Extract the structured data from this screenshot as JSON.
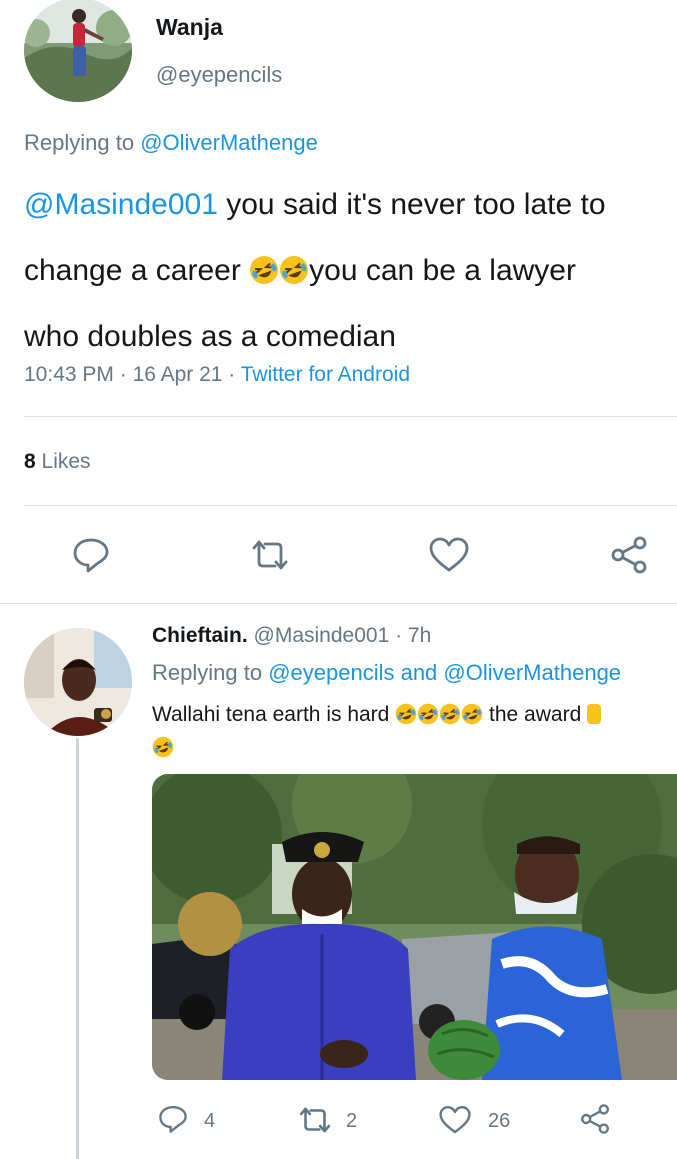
{
  "tweet": {
    "author_name": "Wanja",
    "author_handle": "@eyepencils",
    "replying_prefix": "Replying to ",
    "replying_to": "@OliverMathenge",
    "mention": "@Masinde001",
    "text_1": " you said it's never too late to",
    "text_2a": "change a career ",
    "text_2b": "you can be a lawyer",
    "text_3": "who doubles as a comedian",
    "time": "10:43 PM",
    "sep": " · ",
    "date": "16 Apr 21",
    "source": "Twitter for Android",
    "likes_count": "8",
    "likes_label": " Likes"
  },
  "reply": {
    "author_name": "Chieftain.",
    "author_handle": "@Masinde001",
    "age": "7h",
    "replying_prefix": "Replying to ",
    "replying_to": "@eyepencils and @OliverMathenge",
    "text_1": "Wallahi tena earth is hard ",
    "text_2": " the award ",
    "counts": {
      "replies": "4",
      "retweets": "2",
      "likes": "26"
    }
  },
  "icons": {
    "reply": "reply-icon",
    "retweet": "retweet-icon",
    "like": "heart-icon",
    "share": "share-icon",
    "emoji": "rolling-laughing-emoji"
  },
  "colors": {
    "link": "#1b95e0",
    "secondary": "#657786",
    "divider": "#d9dee3"
  }
}
